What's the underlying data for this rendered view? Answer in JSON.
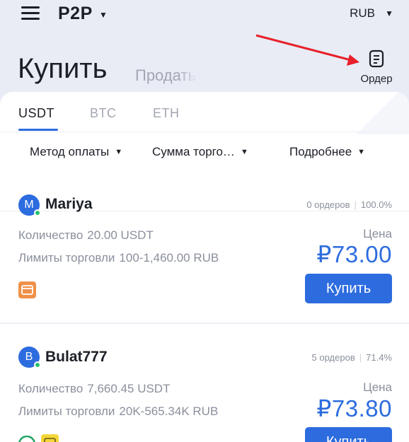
{
  "header": {
    "brand": "P2P",
    "currency": "RUB",
    "menu_icon": "hamburger-icon",
    "caret_icon": "caret-down-icon"
  },
  "mode_tabs": {
    "buy": "Купить",
    "sell": "Продать"
  },
  "orders_button": {
    "label": "Ордер",
    "icon": "document-icon"
  },
  "annotation": {
    "arrow_color": "#e8202a"
  },
  "asset_tabs": [
    "USDT",
    "BTC",
    "ETH"
  ],
  "active_asset": "USDT",
  "filters": {
    "payment_method": "Метод оплаты",
    "trade_amount": "Сумма торго…",
    "more": "Подробнее"
  },
  "ads": [
    {
      "avatar_letter": "M",
      "merchant": "Mariya",
      "orders": "0 ордеров",
      "completion": "100.0%",
      "quantity_label": "Количество",
      "quantity": "20.00 USDT",
      "limits_label": "Лимиты торговли",
      "limits": "100-1,460.00 RUB",
      "price_label": "Цена",
      "price": "₽73.00",
      "buy_label": "Купить",
      "payment_icons": [
        "bank-card-icon"
      ]
    },
    {
      "avatar_letter": "B",
      "merchant": "Bulat777",
      "orders": "5 ордеров",
      "completion": "71.4%",
      "quantity_label": "Количество",
      "quantity": "7,660.45 USDT",
      "limits_label": "Лимиты торговли",
      "limits": "20K-565.34K RUB",
      "price_label": "Цена",
      "price": "₽73.80",
      "buy_label": "Купить",
      "payment_icons": [
        "bank-icon",
        "wallet-icon"
      ]
    }
  ],
  "colors": {
    "accent": "#2d6cdf",
    "online": "#27c26c",
    "background": "#e9ecf5"
  }
}
